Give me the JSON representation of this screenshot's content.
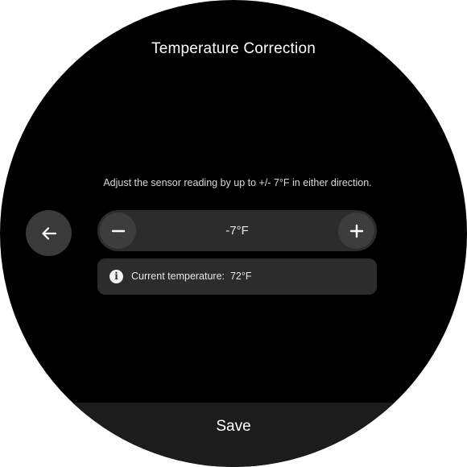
{
  "header": {
    "title": "Temperature Correction"
  },
  "description": "Adjust the sensor reading by up to  +/- 7°F in either direction.",
  "navigation": {
    "back_icon": "arrow-left-icon"
  },
  "stepper": {
    "value": "-7°F",
    "decrement_icon": "minus-icon",
    "increment_icon": "plus-icon"
  },
  "info": {
    "icon": "info-icon",
    "glyph": "i",
    "text": "Current temperature:  72°F"
  },
  "footer": {
    "save_label": "Save"
  },
  "colors": {
    "background": "#000000",
    "surface": "#2c2c2c",
    "button": "#3d3d3d",
    "footer": "#1c1c1c",
    "text": "#ffffff"
  }
}
